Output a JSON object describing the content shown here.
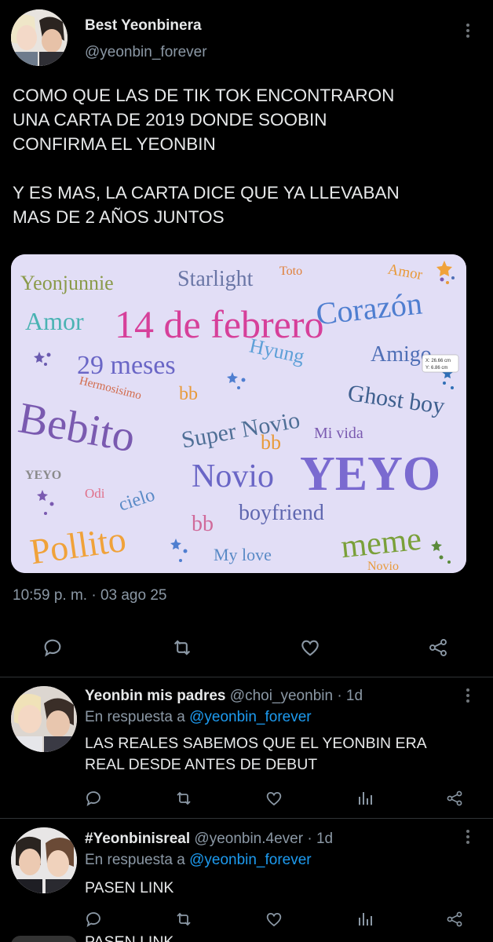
{
  "colors": {
    "background": "#000000",
    "text": "#e7e9ea",
    "secondary": "#8b98a5",
    "link": "#1d9bf0",
    "divider": "#2f3336",
    "card_bg": "#e2def6"
  },
  "tweet": {
    "author_name": "Best Yeonbinera",
    "author_handle": "@yeonbin_forever",
    "text_lines": [
      "COMO QUE LAS DE TIK TOK ENCONTRARON",
      "UNA CARTA DE 2019 DONDE SOOBIN",
      "CONFIRMA EL YEONBIN",
      "Y ES MAS, LA CARTA DICE QUE YA LLEVABAN",
      "MAS DE 2 AÑOS JUNTOS"
    ],
    "timestamp": "10:59 p. m. · 03 ago 25",
    "icons": [
      "reply-icon",
      "retweet-icon",
      "like-icon",
      "share-icon"
    ]
  },
  "card_words": {
    "yeonjunnie": "Yeonjunnie",
    "starlight": "Starlight",
    "toto": "Toto",
    "amor_small": "Amor",
    "corazon": "Corazón",
    "amor": "Amor",
    "fecha": "14 de febrero",
    "meses": "29 meses",
    "hyung": "Hyung",
    "amigo": "Amigo",
    "hermosisimo": "Hermosisimo",
    "bb1": "bb",
    "super_novio": "Super Novio",
    "ghost_boy": "Ghost boy",
    "bebito": "Bebito",
    "mi_vida": "Mi vida",
    "bb2": "bb",
    "yeyo_small": "YEYO",
    "novio": "Novio",
    "yeyo_big": "YEYO",
    "odi": "Odi",
    "cielo": "cielo",
    "pollito": "Pollito",
    "bb3": "bb",
    "boyfriend": "boyfriend",
    "meme": "meme",
    "my_love": "My love",
    "novio_small": "Novio",
    "measure_x": "X: 26.66 cm",
    "measure_y": "Y: 6.86 cm"
  },
  "replies": [
    {
      "name": "Yeonbin mis padres",
      "handle": "@choi_yeonbin",
      "time": "· 1d",
      "reply_label": "En respuesta a",
      "mention": "@yeonbin_forever",
      "text_lines": [
        "LAS REALES SABEMOS QUE EL YEONBIN ERA",
        "REAL DESDE ANTES DE DEBUT"
      ]
    },
    {
      "name": "#Yeonbinisreal",
      "handle": "@yeonbin.4ever",
      "time": "· 1d",
      "reply_label": "En respuesta a",
      "mention": "@yeonbin_forever",
      "text_lines": [
        "PASEN LINK"
      ]
    }
  ],
  "peek_text": "PASEN LINK"
}
